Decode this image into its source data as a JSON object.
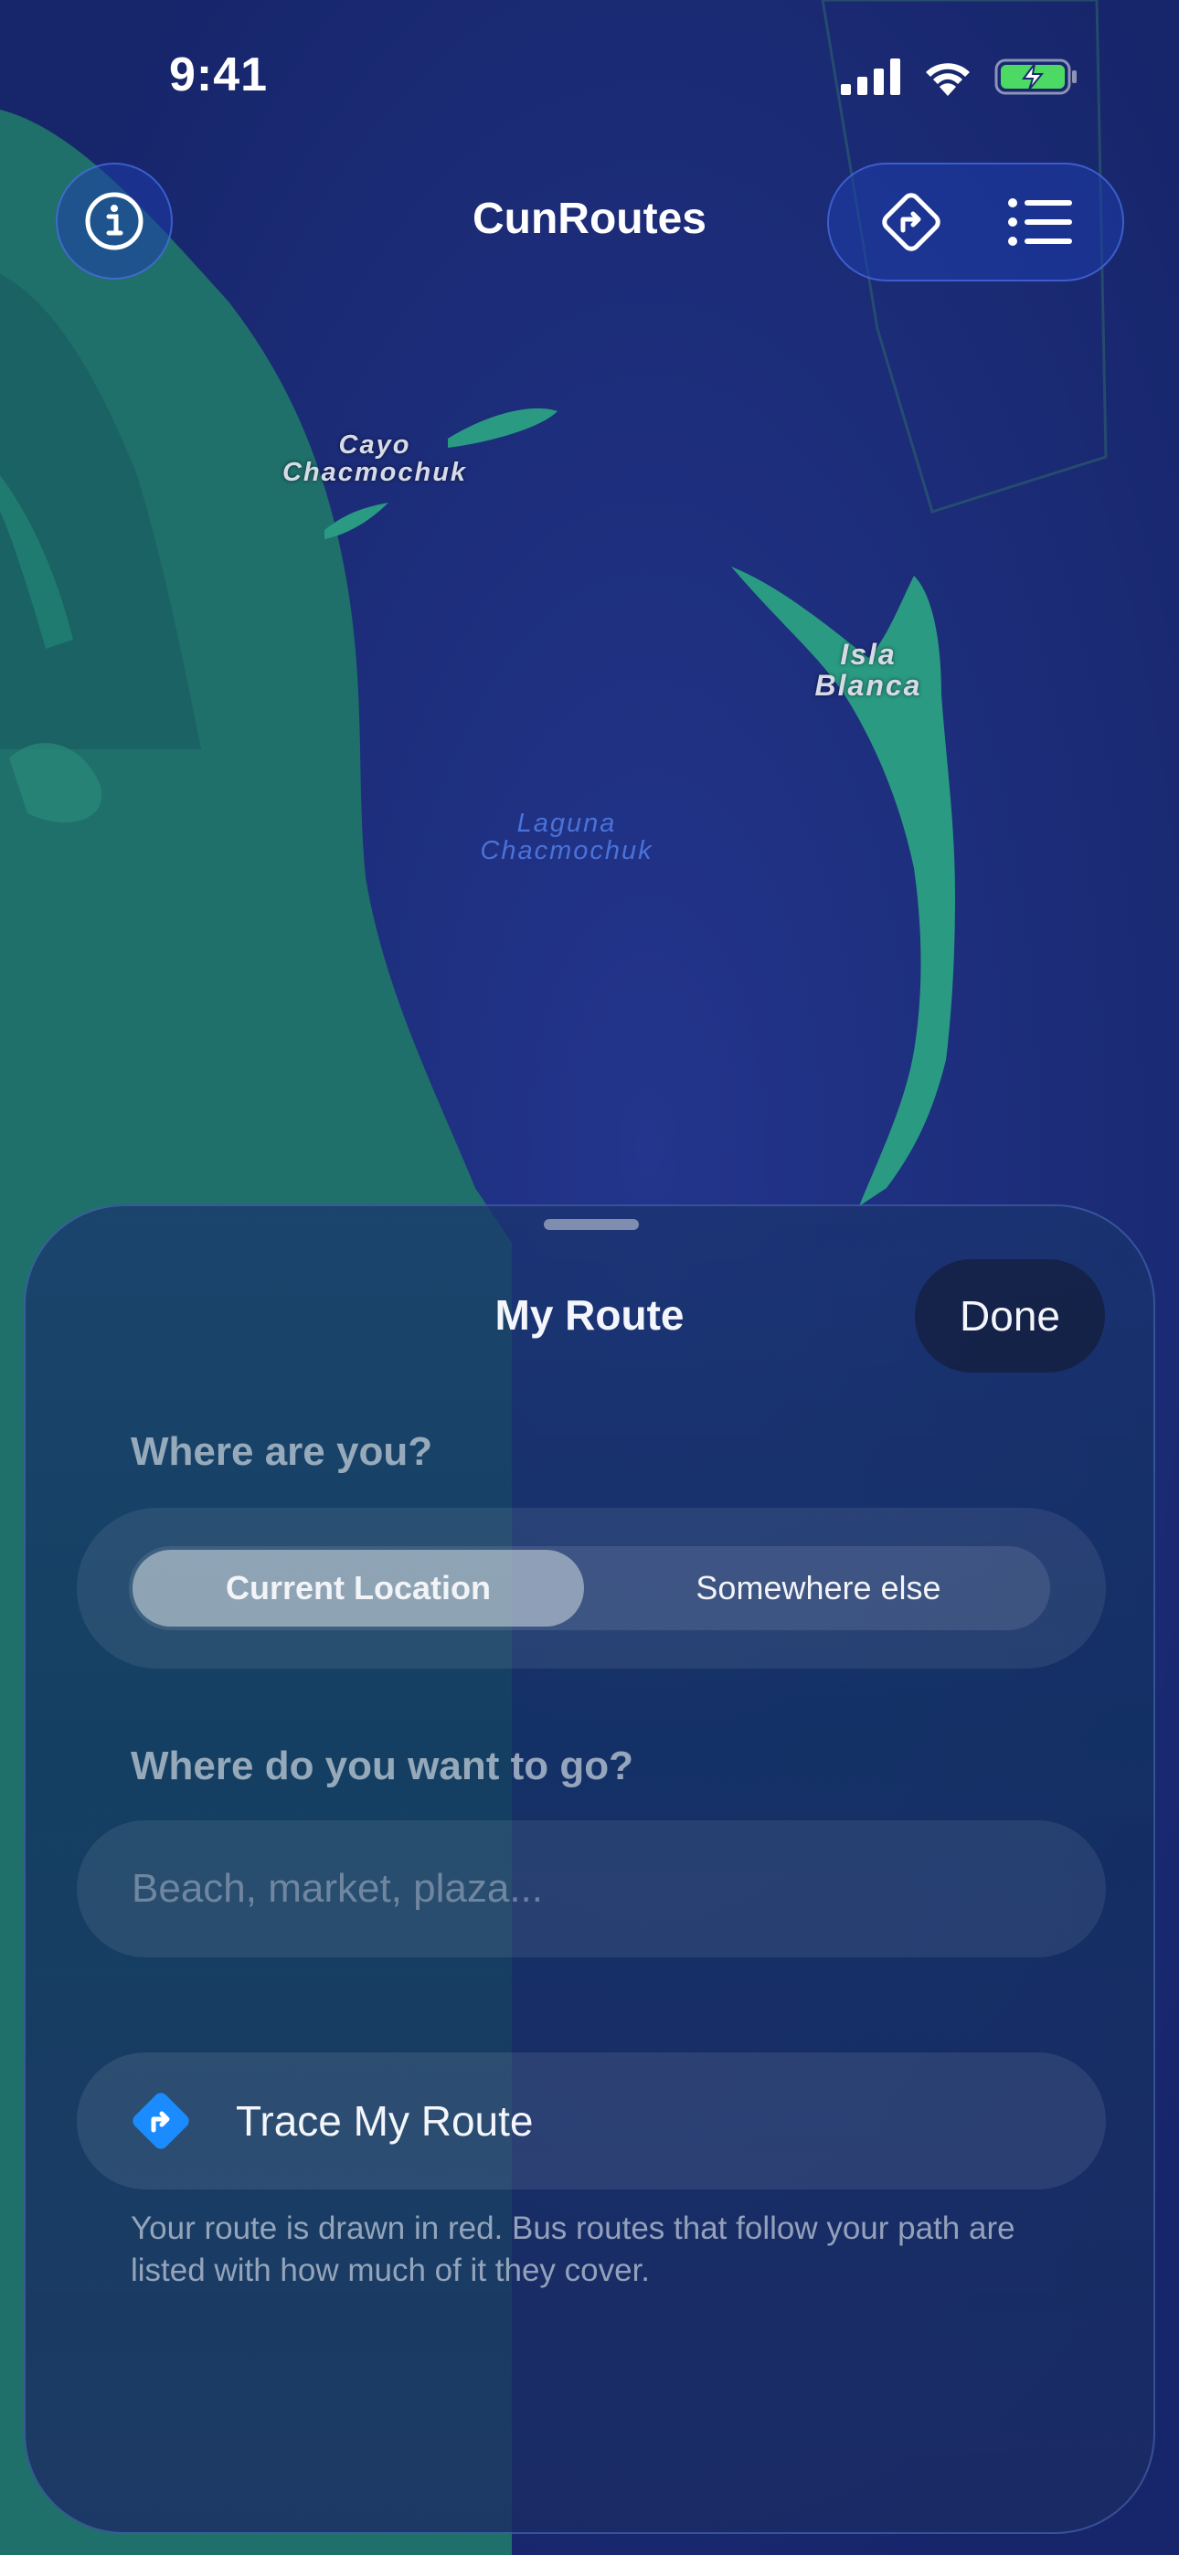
{
  "status_bar": {
    "time": "9:41",
    "icons": [
      "cellular-signal-icon",
      "wifi-icon",
      "battery-charging-icon"
    ],
    "battery_color": "#4cd964"
  },
  "header": {
    "title": "CunRoutes",
    "info_icon": "info-icon",
    "directions_icon": "directions-icon",
    "list_icon": "list-icon"
  },
  "map": {
    "labels": [
      {
        "text_line1": "Cayo",
        "text_line2": "Chacmochuk",
        "kind": "land"
      },
      {
        "text_line1": "Isla",
        "text_line2": "Blanca",
        "kind": "land"
      },
      {
        "text_line1": "Laguna",
        "text_line2": "Chacmochuk",
        "kind": "water"
      }
    ],
    "colors": {
      "water": "#1c2c7a",
      "land": "#1f6f6a"
    }
  },
  "sheet": {
    "title": "My Route",
    "done_label": "Done",
    "origin": {
      "label": "Where are you?",
      "options": [
        "Current Location",
        "Somewhere else"
      ],
      "selected": "Current Location"
    },
    "destination": {
      "label": "Where do you want to go?",
      "placeholder": "Beach, market, plaza...",
      "value": ""
    },
    "trace": {
      "label": "Trace My Route",
      "icon": "turn-right-sign-icon",
      "icon_color": "#1a8cff"
    },
    "footnote": "Your route is drawn in red. Bus routes that follow your path are listed with how much of it they cover."
  }
}
